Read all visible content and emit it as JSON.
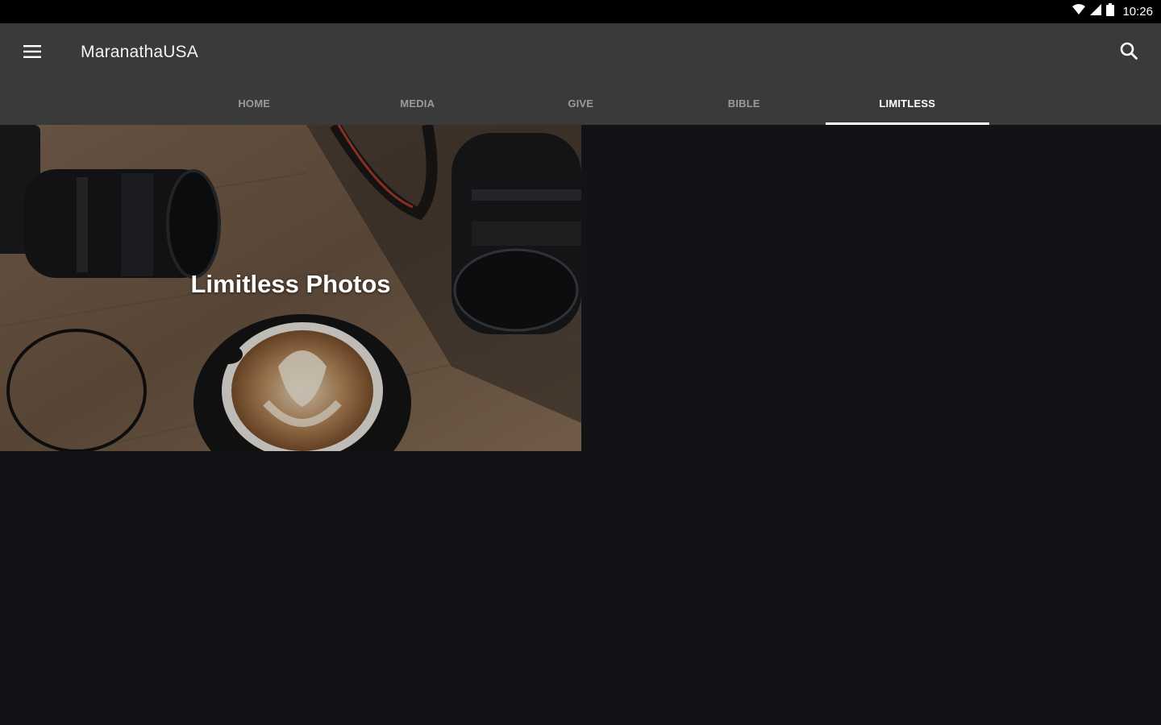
{
  "status_bar": {
    "time": "10:26",
    "icons": [
      "wifi-icon",
      "signal-icon",
      "battery-icon"
    ]
  },
  "app": {
    "title": "MaranathaUSA",
    "menu_icon": "hamburger-menu-icon",
    "search_icon": "search-icon"
  },
  "tabs": [
    {
      "label": "HOME",
      "active": false
    },
    {
      "label": "MEDIA",
      "active": false
    },
    {
      "label": "GIVE",
      "active": false
    },
    {
      "label": "BIBLE",
      "active": false
    },
    {
      "label": "LIMITLESS",
      "active": true
    }
  ],
  "content": {
    "cards": [
      {
        "title": "Limitless Photos"
      }
    ]
  },
  "colors": {
    "status_bar": "#000000",
    "app_bar": "#3a3a3a",
    "background": "#111316",
    "tab_active": "#ffffff",
    "tab_inactive": "#9a9a9a"
  }
}
